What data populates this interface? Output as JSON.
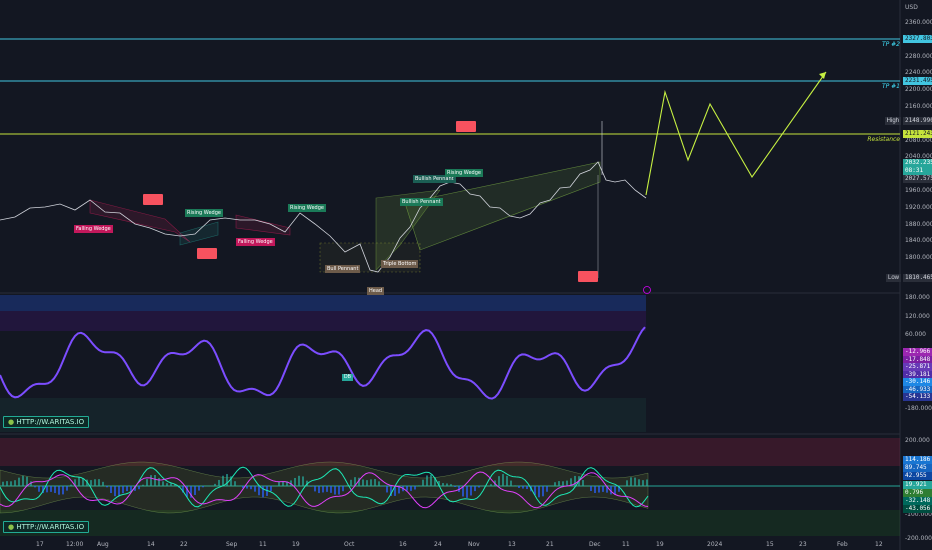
{
  "currency": "USD",
  "price_axis": [
    "2360.000",
    "2320.000",
    "2280.000",
    "2240.000",
    "2200.000",
    "2160.000",
    "2120.000",
    "2080.000",
    "2040.000",
    "2000.000",
    "1960.000",
    "1920.000",
    "1880.000",
    "1840.000",
    "1800.000"
  ],
  "price_tags": {
    "tp2": "2327.803",
    "tp1": "2231.495",
    "high_label": "High",
    "high": "2148.990",
    "resistance": "2121.243",
    "current1": "2032.235",
    "current_time": "08:31",
    "current2": "2027.575",
    "low_label": "Low",
    "low": "1810.465"
  },
  "lines": {
    "tp2": "TP #2",
    "tp1": "TP #1",
    "resistance": "Resistance"
  },
  "patterns": [
    {
      "text": "Falling Wedge",
      "color": "#e91e63"
    },
    {
      "text": "Rising Wedge",
      "color": "#26a69a"
    },
    {
      "text": "Falling Wedge",
      "color": "#e91e63"
    },
    {
      "text": "Rising Wedge",
      "color": "#26a69a"
    },
    {
      "text": "Bullish Pennant",
      "color": "#26a69a"
    },
    {
      "text": "Rising Wedge",
      "color": "#26a69a"
    },
    {
      "text": "Bullish Pennant",
      "color": "#26a69a"
    },
    {
      "text": "Bull Pennant",
      "color": "#26a69a"
    },
    {
      "text": "Triple Bottom",
      "color": "#a1887f"
    },
    {
      "text": "Head",
      "color": "#a1887f"
    }
  ],
  "osc1": {
    "axis": [
      "180.000",
      "120.000",
      "60.000",
      "0.000",
      "-60.000",
      "-120.000",
      "-180.000"
    ],
    "tags": [
      "-12.966",
      "-17.848",
      "-25.871",
      "-39.181",
      "-30.146",
      "-46.933",
      "-54.133"
    ],
    "tag_colors": [
      "#9c27b0",
      "#7b1fa2",
      "#673ab7",
      "#512da8",
      "#1e88e5",
      "#1565c0",
      "#283593"
    ],
    "badge": "DB",
    "watermark": "HTTP://W.ARITAS.IO"
  },
  "osc2": {
    "axis": [
      "200.000",
      "100.000",
      "0.000",
      "-100.000",
      "-200.000"
    ],
    "tags": [
      "114.186",
      "89.745",
      "42.955",
      "19.921",
      "0.796",
      "-32.148",
      "-43.056"
    ],
    "tag_colors": [
      "#1976d2",
      "#1565c0",
      "#0d47a1",
      "#26a69a",
      "#2e7d32",
      "#00695c",
      "#004d40"
    ],
    "watermark": "HTTP://W.ARITAS.IO"
  },
  "time_axis": [
    "17",
    "12:00",
    "Aug",
    "14",
    "22",
    "Sep",
    "11",
    "19",
    "Oct",
    "16",
    "24",
    "Nov",
    "13",
    "21",
    "Dec",
    "11",
    "19",
    "2024",
    "15",
    "23",
    "Feb",
    "12"
  ]
}
